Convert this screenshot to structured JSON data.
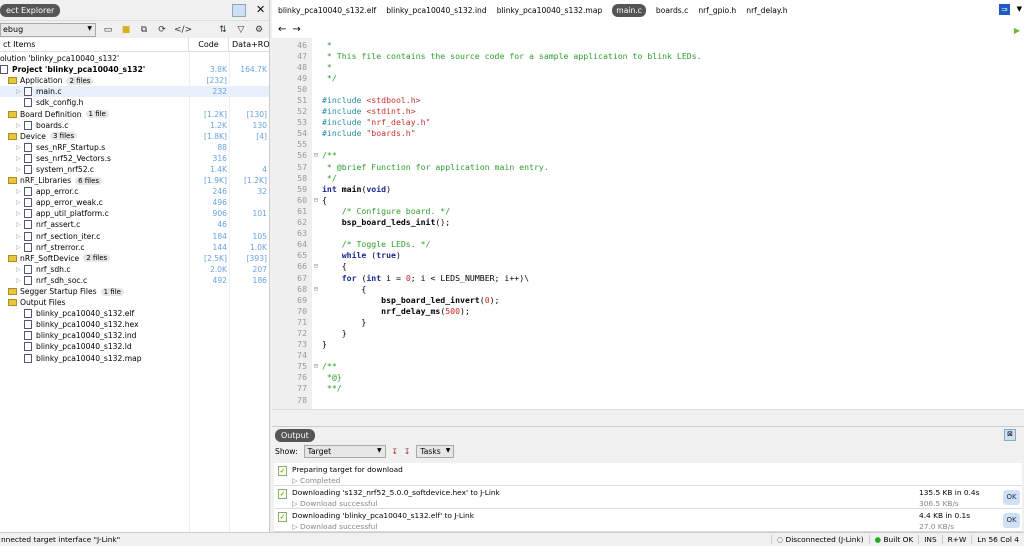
{
  "explorer": {
    "title": "ect Explorer",
    "config": "ebug",
    "col_items": "ct Items",
    "col_code": "Code",
    "col_data": "Data+RO",
    "rows": [
      {
        "lvl": 0,
        "type": "sol",
        "name": "olution 'blinky_pca10040_s132'",
        "code": "",
        "data": ""
      },
      {
        "lvl": 0,
        "type": "proj",
        "name": "Project 'blinky_pca10040_s132'",
        "code": "3.8K",
        "data": "164.7K"
      },
      {
        "lvl": 1,
        "type": "folder",
        "name": "Application",
        "count": "2 files",
        "code": "[232]",
        "data": ""
      },
      {
        "lvl": 2,
        "type": "file",
        "exp": true,
        "name": "main.c",
        "code": "232",
        "data": "",
        "selected": true
      },
      {
        "lvl": 2,
        "type": "file",
        "name": "sdk_config.h",
        "code": "",
        "data": ""
      },
      {
        "lvl": 1,
        "type": "folder",
        "name": "Board Definition",
        "count": "1 file",
        "code": "[1.2K]",
        "data": "[130]"
      },
      {
        "lvl": 2,
        "type": "file",
        "exp": true,
        "name": "boards.c",
        "code": "1.2K",
        "data": "130"
      },
      {
        "lvl": 1,
        "type": "folder",
        "name": "Device",
        "count": "3 files",
        "code": "[1.8K]",
        "data": "[4]"
      },
      {
        "lvl": 2,
        "type": "file",
        "exp": true,
        "name": "ses_nRF_Startup.s",
        "code": "88",
        "data": ""
      },
      {
        "lvl": 2,
        "type": "file",
        "exp": true,
        "name": "ses_nrf52_Vectors.s",
        "code": "316",
        "data": ""
      },
      {
        "lvl": 2,
        "type": "file",
        "exp": true,
        "name": "system_nrf52.c",
        "code": "1.4K",
        "data": "4"
      },
      {
        "lvl": 1,
        "type": "folder",
        "name": "nRF_Libraries",
        "count": "6 files",
        "code": "[1.9K]",
        "data": "[1.2K]"
      },
      {
        "lvl": 2,
        "type": "file",
        "exp": true,
        "name": "app_error.c",
        "code": "246",
        "data": "32"
      },
      {
        "lvl": 2,
        "type": "file",
        "exp": true,
        "name": "app_error_weak.c",
        "code": "496",
        "data": ""
      },
      {
        "lvl": 2,
        "type": "file",
        "exp": true,
        "name": "app_util_platform.c",
        "code": "906",
        "data": "101"
      },
      {
        "lvl": 2,
        "type": "file",
        "exp": true,
        "name": "nrf_assert.c",
        "code": "46",
        "data": ""
      },
      {
        "lvl": 2,
        "type": "file",
        "exp": true,
        "name": "nrf_section_iter.c",
        "code": "184",
        "data": "105"
      },
      {
        "lvl": 2,
        "type": "file",
        "exp": true,
        "name": "nrf_strerror.c",
        "code": "144",
        "data": "1.0K"
      },
      {
        "lvl": 1,
        "type": "folder",
        "name": "nRF_SoftDevice",
        "count": "2 files",
        "code": "[2.5K]",
        "data": "[393]"
      },
      {
        "lvl": 2,
        "type": "file",
        "exp": true,
        "name": "nrf_sdh.c",
        "code": "2.0K",
        "data": "207"
      },
      {
        "lvl": 2,
        "type": "file",
        "exp": true,
        "name": "nrf_sdh_soc.c",
        "code": "492",
        "data": "186"
      },
      {
        "lvl": 1,
        "type": "folder",
        "name": "Segger Startup Files",
        "count": "1 file",
        "code": "",
        "data": ""
      },
      {
        "lvl": 1,
        "type": "folder",
        "name": "Output Files",
        "code": "",
        "data": ""
      },
      {
        "lvl": 2,
        "type": "file",
        "name": "blinky_pca10040_s132.elf",
        "code": "",
        "data": ""
      },
      {
        "lvl": 2,
        "type": "file",
        "name": "blinky_pca10040_s132.hex",
        "code": "",
        "data": ""
      },
      {
        "lvl": 2,
        "type": "file",
        "name": "blinky_pca10040_s132.ind",
        "code": "",
        "data": ""
      },
      {
        "lvl": 2,
        "type": "file",
        "name": "blinky_pca10040_s132.ld",
        "code": "",
        "data": ""
      },
      {
        "lvl": 2,
        "type": "file",
        "name": "blinky_pca10040_s132.map",
        "code": "",
        "data": ""
      }
    ]
  },
  "editor": {
    "tabs": [
      "blinky_pca10040_s132.elf",
      "blinky_pca10040_s132.ind",
      "blinky_pca10040_s132.map",
      "main.c",
      "boards.c",
      "nrf_gpio.h",
      "nrf_delay.h"
    ],
    "active_tab": "main.c",
    "back": "←",
    "forward": "→",
    "lines": [
      {
        "n": "46",
        "s": [
          [
            "c",
            " *"
          ]
        ]
      },
      {
        "n": "47",
        "s": [
          [
            "c",
            " * This file contains the source code for a sample application to blink LEDs."
          ]
        ]
      },
      {
        "n": "48",
        "s": [
          [
            "c",
            " *"
          ]
        ]
      },
      {
        "n": "49",
        "s": [
          [
            "c",
            " */"
          ]
        ]
      },
      {
        "n": "50",
        "s": []
      },
      {
        "n": "51",
        "s": [
          [
            "pp",
            "#include "
          ],
          [
            "str",
            "<stdbool.h>"
          ]
        ]
      },
      {
        "n": "52",
        "s": [
          [
            "pp",
            "#include "
          ],
          [
            "str",
            "<stdint.h>"
          ]
        ]
      },
      {
        "n": "53",
        "s": [
          [
            "pp",
            "#include "
          ],
          [
            "str",
            "\"nrf_delay.h\""
          ]
        ]
      },
      {
        "n": "54",
        "s": [
          [
            "pp",
            "#include "
          ],
          [
            "str",
            "\"boards.h\""
          ]
        ]
      },
      {
        "n": "55",
        "s": []
      },
      {
        "n": "56",
        "f": true,
        "s": [
          [
            "c",
            "/**"
          ]
        ]
      },
      {
        "n": "57",
        "s": [
          [
            "c",
            " * @brief Function for application main entry."
          ]
        ]
      },
      {
        "n": "58",
        "s": [
          [
            "c",
            " */"
          ]
        ]
      },
      {
        "n": "59",
        "s": [
          [
            "kw",
            "int "
          ],
          [
            "fn",
            "main"
          ],
          [
            "pl",
            "("
          ],
          [
            "kw",
            "void"
          ],
          [
            "pl",
            ")"
          ]
        ]
      },
      {
        "n": "60",
        "f": true,
        "s": [
          [
            "pl",
            "{"
          ]
        ]
      },
      {
        "n": "61",
        "s": [
          [
            "c",
            "    /* Configure board. */"
          ]
        ]
      },
      {
        "n": "62",
        "s": [
          [
            "fn",
            "    bsp_board_leds_init"
          ],
          [
            "pl",
            "();"
          ]
        ]
      },
      {
        "n": "63",
        "s": []
      },
      {
        "n": "64",
        "s": [
          [
            "c",
            "    /* Toggle LEDs. */"
          ]
        ]
      },
      {
        "n": "65",
        "s": [
          [
            "kw",
            "    while "
          ],
          [
            "pl",
            "("
          ],
          [
            "kw",
            "true"
          ],
          [
            "pl",
            ")"
          ]
        ]
      },
      {
        "n": "66",
        "f": true,
        "s": [
          [
            "pl",
            "    {"
          ]
        ]
      },
      {
        "n": "67",
        "s": [
          [
            "kw",
            "    for "
          ],
          [
            "pl",
            "("
          ],
          [
            "kw",
            "int "
          ],
          [
            "pl",
            "i = "
          ],
          [
            "num2",
            "0"
          ],
          [
            "pl",
            "; i < LEDS_NUMBER; i++)\\"
          ]
        ]
      },
      {
        "n": "68",
        "f": true,
        "s": [
          [
            "pl",
            "        {"
          ]
        ]
      },
      {
        "n": "69",
        "s": [
          [
            "fn",
            "            bsp_board_led_invert"
          ],
          [
            "pl",
            "("
          ],
          [
            "num2",
            "0"
          ],
          [
            "pl",
            ");"
          ]
        ]
      },
      {
        "n": "70",
        "s": [
          [
            "fn",
            "            nrf_delay_ms"
          ],
          [
            "pl",
            "("
          ],
          [
            "num2",
            "500"
          ],
          [
            "pl",
            ");"
          ]
        ]
      },
      {
        "n": "71",
        "s": [
          [
            "pl",
            "        }"
          ]
        ]
      },
      {
        "n": "72",
        "s": [
          [
            "pl",
            "    }"
          ]
        ]
      },
      {
        "n": "73",
        "s": [
          [
            "pl",
            "}"
          ]
        ]
      },
      {
        "n": "74",
        "s": []
      },
      {
        "n": "75",
        "f": true,
        "s": [
          [
            "c",
            "/**"
          ]
        ]
      },
      {
        "n": "76",
        "s": [
          [
            "c",
            " *@}"
          ]
        ]
      },
      {
        "n": "77",
        "s": [
          [
            "c",
            " **/"
          ]
        ]
      },
      {
        "n": "78",
        "s": []
      }
    ]
  },
  "output": {
    "title": "Output",
    "show_label": "Show:",
    "show_value": "Target",
    "filter_value": "Tasks",
    "entries": [
      {
        "title": "Preparing target for download",
        "detail": "Completed",
        "size": "",
        "rate": "",
        "ok": ""
      },
      {
        "title": "Downloading 's132_nrf52_5.0.0_softdevice.hex' to J-Link",
        "detail": "Download successful",
        "size": "135.5 KB in 0.4s",
        "rate": "306.5 KB/s",
        "ok": "OK"
      },
      {
        "title": "Downloading 'blinky_pca10040_s132.elf' to J-Link",
        "detail": "Download successful",
        "size": "4.4 KB in 0.1s",
        "rate": "27.0 KB/s",
        "ok": "OK"
      }
    ]
  },
  "status": {
    "message": "nnected target interface \"J-Link\"",
    "connection": "Disconnected (J-Link)",
    "build": "Built OK",
    "mode": "INS",
    "access": "R+W",
    "position": "Ln 56 Col 4"
  }
}
